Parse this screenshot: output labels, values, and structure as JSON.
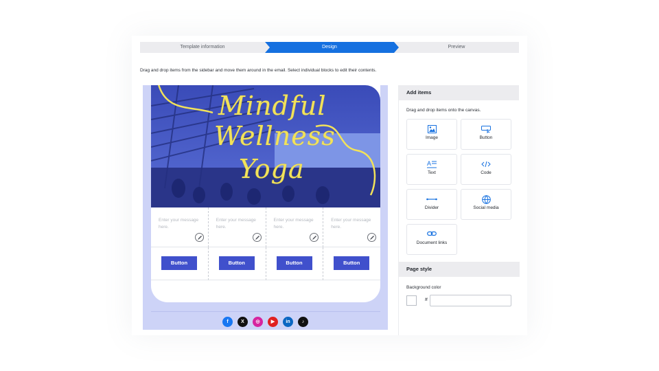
{
  "steps": [
    {
      "label": "Template information"
    },
    {
      "label": "Design"
    },
    {
      "label": "Preview"
    }
  ],
  "instructions": "Drag and drop items from the sidebar and move them around in the email. Select individual blocks to edit their contents.",
  "email": {
    "hero_title_lines": [
      "Mindful",
      "Wellness",
      "Yoga"
    ],
    "message_placeholder": "Enter your message here.",
    "button_label": "Button",
    "social_icons": [
      {
        "name": "facebook",
        "glyph": "f",
        "color": "#1877f2"
      },
      {
        "name": "x",
        "glyph": "X",
        "color": "#111111"
      },
      {
        "name": "instagram",
        "glyph": "◎",
        "color": "#d6249f"
      },
      {
        "name": "youtube",
        "glyph": "▶",
        "color": "#e02020"
      },
      {
        "name": "linkedin",
        "glyph": "in",
        "color": "#0a66c2"
      },
      {
        "name": "tiktok",
        "glyph": "♪",
        "color": "#111111"
      }
    ]
  },
  "panel": {
    "add_items_title": "Add items",
    "add_items_hint": "Drag and drop items onto the canvas.",
    "tiles": [
      {
        "label": "Image",
        "icon": "image-icon"
      },
      {
        "label": "Button",
        "icon": "button-icon"
      },
      {
        "label": "Text",
        "icon": "text-icon"
      },
      {
        "label": "Code",
        "icon": "code-icon"
      },
      {
        "label": "Divider",
        "icon": "divider-icon"
      },
      {
        "label": "Social media",
        "icon": "social-media-icon"
      },
      {
        "label": "Document links",
        "icon": "link-icon"
      }
    ],
    "page_style_title": "Page style",
    "background_color_label": "Background color",
    "hash_symbol": "#",
    "background_color_value": ""
  },
  "colors": {
    "accent": "#1570e0",
    "email_button": "#4050cc",
    "title_yellow": "#f2e25a",
    "canvas_bg": "#cdd3f7"
  }
}
